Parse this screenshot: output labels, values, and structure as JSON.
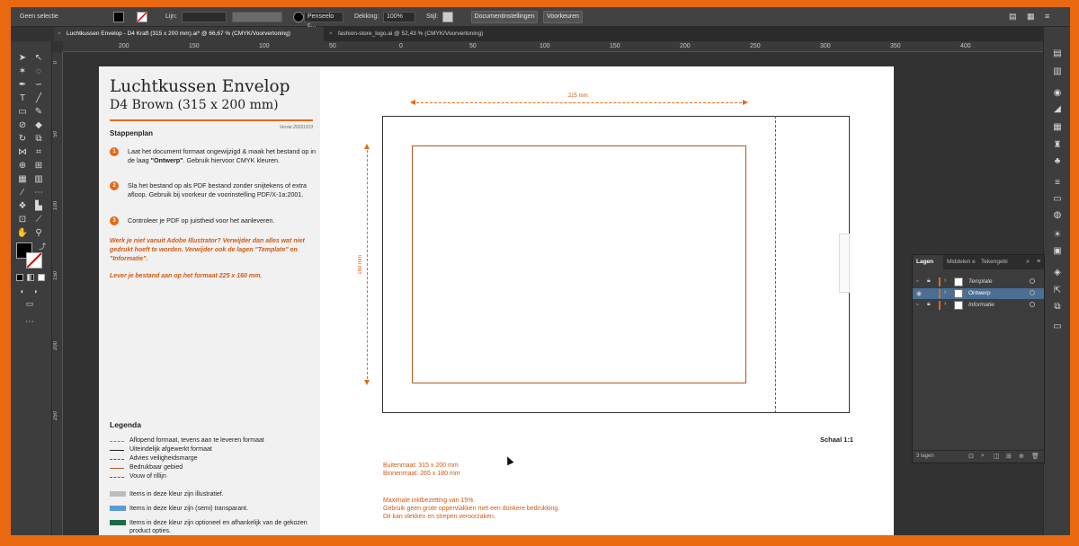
{
  "control_bar": {
    "selection": "Geen selectie",
    "stroke_label": "Lijn:",
    "brush_name": "Penseelo c...",
    "opacity_label": "Dekking:",
    "opacity_value": "100%",
    "style_label": "Stijl:",
    "doc_settings_button": "Documentinstellingen",
    "preferences_button": "Voorkeuren"
  },
  "tabs": [
    {
      "label": "Luchtkussen Envelop - D4 Kraft (315 x 200 mm).ai* @ 66,67 % (CMYK/Voorvertoning)"
    },
    {
      "label": "fashion-store_logo.ai @ 52,43 % (CMYK/Voorvertoning)"
    }
  ],
  "ruler": {
    "h_ticks": [
      "200",
      "150",
      "100",
      "50",
      "0",
      "50",
      "100",
      "150",
      "200",
      "250",
      "300",
      "350",
      "400"
    ],
    "v_ticks": [
      "0",
      "50",
      "100",
      "150",
      "200",
      "250"
    ]
  },
  "artboard": {
    "title": "Luchtkussen Envelop",
    "subtitle": "D4 Brown (315 x 200 mm)",
    "version": "Versie 20221103",
    "steps_heading": "Stappenplan",
    "steps": [
      {
        "num": "1",
        "text": "Laat het document formaat ongewijzigd & maak het bestand op in de laag",
        "bold": "\"Ontwerp\"",
        "after": ". Gebruik hiervoor CMYK kleuren."
      },
      {
        "num": "2",
        "text": "Sla het bestand op als PDF bestand zonder snijtekens of extra afloop. Gebruik bij voorkeur de voorinstelling PDF/X-1a:2001.",
        "bold": "",
        "after": ""
      },
      {
        "num": "3",
        "text": "Controleer je PDF op juistheid voor het aanleveren.",
        "bold": "",
        "after": ""
      }
    ],
    "note1": "Werk je niet vanuit Adobe Illustrator? Verwijder dan alles wat niet gedrukt hoeft te worden. Verwijder ook de lagen \"Template\" en \"Informatie\".",
    "note2": "Lever je bestand aan op het formaat 225 x 160 mm.",
    "legend_title": "Legenda",
    "legend_lines": [
      {
        "label": "Aflopend formaat, tevens aan te leveren formaat",
        "color": "#e26a16",
        "style": "dashed"
      },
      {
        "label": "Uiteindelijk afgewerkt formaat",
        "color": "#222222",
        "style": "solid"
      },
      {
        "label": "Advies veiligheidsmarge",
        "color": "#555555",
        "style": "dashed"
      },
      {
        "label": "Bedrukbaar gebied",
        "color": "#b05a20",
        "style": "solid"
      },
      {
        "label": "Vouw of rillijn",
        "color": "#c0392b",
        "style": "dashed"
      }
    ],
    "legend_colors": [
      {
        "label": "Items in deze kleur zijn illustratief.",
        "color": "#bdbdbd"
      },
      {
        "label": "Items in deze kleur zijn (semi) transparant.",
        "color": "#5b9bd5"
      },
      {
        "label": "Items in deze kleur zijn optioneel en afhankelijk van de gekozen product opties.",
        "color": "#1e6b4a"
      }
    ],
    "dim_width": "225 mm",
    "dim_height": "160 mm",
    "scale": "Schaal 1:1",
    "outer_size": "Buitenmaat: 315 x 200 mm",
    "inner_size": "Binnenmaat: 265 x 180 mm",
    "ink_notes": [
      "Maximale inktbezetting van 15%.",
      "Gebruik geen grote oppervlakken met een donkere bedrukking.",
      "Dit kan vlekken en strepen veroorzaken."
    ]
  },
  "layers_panel": {
    "tabs": [
      "Lagen",
      "Middelen e",
      "Tekengebi"
    ],
    "layers": [
      {
        "name": "Template",
        "color": "#e26a16",
        "selected": false
      },
      {
        "name": "Ontwerp",
        "color": "#e26a16",
        "selected": true
      },
      {
        "name": "Informatie",
        "color": "#e26a16",
        "selected": false
      }
    ],
    "count": "3 lagen"
  }
}
